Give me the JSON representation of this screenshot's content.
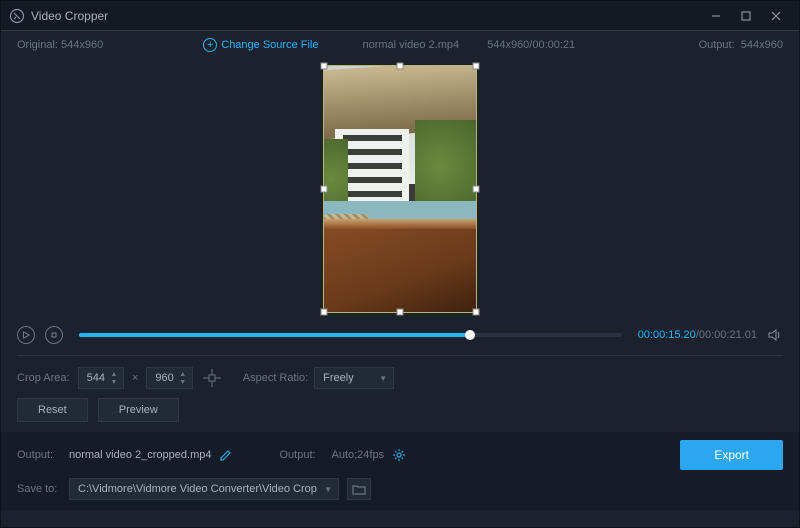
{
  "titlebar": {
    "app_name": "Video Cropper"
  },
  "infobar": {
    "original_label": "Original:",
    "original_dims": "544x960",
    "change_source": "Change Source File",
    "filename": "normal video 2.mp4",
    "dims_time": "544x960/00:00:21",
    "output_label": "Output:",
    "output_dims": "544x960"
  },
  "playback": {
    "current": "00:00:15.20",
    "total": "00:00:21.01"
  },
  "crop": {
    "area_label": "Crop Area:",
    "width": "544",
    "times": "×",
    "height": "960",
    "aspect_label": "Aspect Ratio:",
    "aspect_value": "Freely"
  },
  "buttons": {
    "reset": "Reset",
    "preview": "Preview",
    "export": "Export"
  },
  "output": {
    "output_label": "Output:",
    "output_name": "normal video 2_cropped.mp4",
    "format_label": "Output:",
    "format_value": "Auto;24fps",
    "saveto_label": "Save to:",
    "saveto_path": "C:\\Vidmore\\Vidmore Video Converter\\Video Crop"
  }
}
